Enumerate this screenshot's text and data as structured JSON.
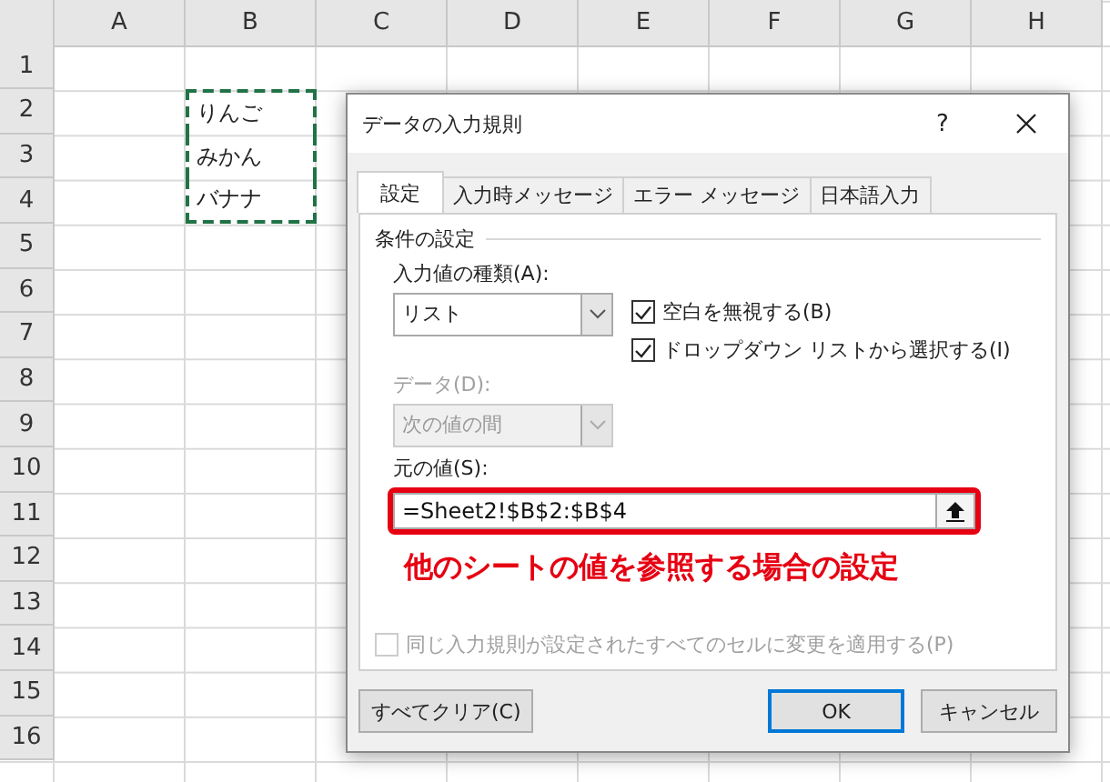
{
  "sheet": {
    "columns": [
      "A",
      "B",
      "C",
      "D",
      "E",
      "F",
      "G",
      "H"
    ],
    "rows": [
      {
        "label": "1",
        "marquee": false
      },
      {
        "label": "2",
        "cell_B": "りんご",
        "marquee": true
      },
      {
        "label": "3",
        "cell_B": "みかん",
        "marquee": true
      },
      {
        "label": "4",
        "cell_B": "バナナ",
        "marquee": true
      },
      {
        "label": "5",
        "marquee": false
      },
      {
        "label": "6",
        "marquee": false
      },
      {
        "label": "7",
        "marquee": false
      },
      {
        "label": "8",
        "marquee": false
      },
      {
        "label": "9",
        "marquee": false
      },
      {
        "label": "10",
        "marquee": false
      },
      {
        "label": "11",
        "marquee": false
      },
      {
        "label": "12",
        "marquee": false
      },
      {
        "label": "13",
        "marquee": false
      },
      {
        "label": "14",
        "marquee": false
      },
      {
        "label": "15",
        "marquee": false
      },
      {
        "label": "16",
        "marquee": false
      }
    ]
  },
  "dialog": {
    "title": "データの入力規則",
    "help": "?",
    "tabs": [
      {
        "label": "設定",
        "selected": true
      },
      {
        "label": "入力時メッセージ",
        "selected": false
      },
      {
        "label": "エラー メッセージ",
        "selected": false
      },
      {
        "label": "日本語入力",
        "selected": false
      }
    ],
    "group_title": "条件の設定",
    "allow": {
      "label": "入力値の種類(A):",
      "value": "リスト",
      "disabled": false
    },
    "data": {
      "label": "データ(D):",
      "value": "次の値の間",
      "disabled": true
    },
    "options": [
      {
        "label": "空白を無視する(B)",
        "checked": true
      },
      {
        "label": "ドロップダウン リストから選択する(I)",
        "checked": true
      }
    ],
    "source": {
      "label": "元の値(S):",
      "value": "=Sheet2!$B$2:$B$4",
      "highlighted": true
    },
    "annotation": "他のシートの値を参照する場合の設定",
    "apply_all": {
      "label": "同じ入力規則が設定されたすべてのセルに変更を適用する(P)",
      "checked": false,
      "disabled": true
    },
    "buttons": [
      {
        "label": "すべてクリア(C)",
        "default": false
      },
      {
        "label": "OK",
        "default": true
      },
      {
        "label": "キャンセル",
        "default": false
      }
    ]
  }
}
